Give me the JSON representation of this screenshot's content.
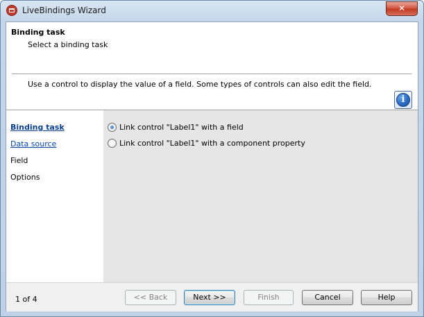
{
  "window": {
    "title": "LiveBindings Wizard",
    "close_label": "✕",
    "app_icon": "delphi-app-icon"
  },
  "header": {
    "title": "Binding task",
    "subtitle": "Select a binding task",
    "description": "Use a control to display the value of a field.  Some types of controls can also edit the field.",
    "info_icon_glyph": "i"
  },
  "nav": {
    "items": [
      {
        "label": "Binding task",
        "state": "active"
      },
      {
        "label": "Data source",
        "state": "link"
      },
      {
        "label": "Field",
        "state": "plain"
      },
      {
        "label": "Options",
        "state": "plain"
      }
    ]
  },
  "options": {
    "choices": [
      {
        "label": "Link control \"Label1\" with a field",
        "checked": true
      },
      {
        "label": "Link control \"Label1\" with a component property",
        "checked": false
      }
    ]
  },
  "footer": {
    "page_indicator": "1 of 4",
    "back_label": "<< Back",
    "next_label": "Next >>",
    "finish_label": "Finish",
    "cancel_label": "Cancel",
    "help_label": "Help"
  },
  "colors": {
    "link": "#0645ad",
    "content_bg": "#e6e6e6",
    "title_close": "#c23a22"
  }
}
